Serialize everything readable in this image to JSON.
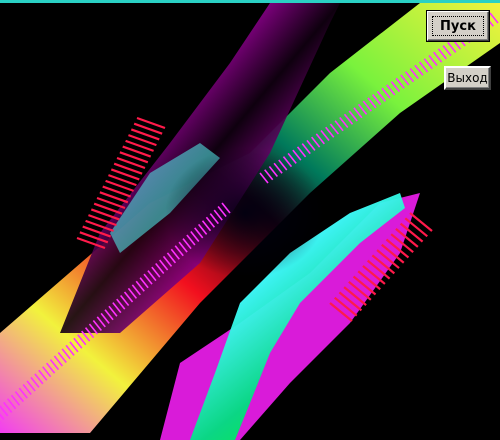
{
  "window": {
    "accent_line_color": "#2ad0c4",
    "background": "#000000"
  },
  "buttons": {
    "start_label": "Пуск",
    "exit_label": "Выход"
  },
  "artwork": {
    "description_colors": [
      "#ff00ff",
      "#ffff00",
      "#00ff00",
      "#00ffff",
      "#ff0040"
    ],
    "tick_color": "#ff1a4a"
  }
}
